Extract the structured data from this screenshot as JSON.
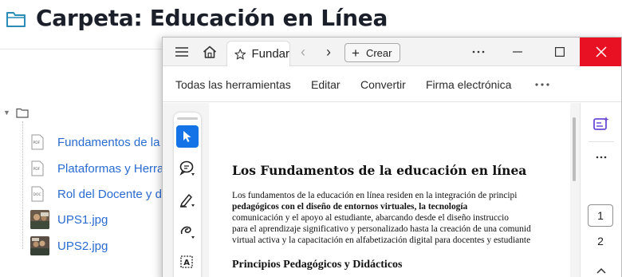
{
  "folder": {
    "title": "Carpeta: Educación en Línea",
    "files": [
      {
        "name": "Fundamentos de la",
        "type": "pdf"
      },
      {
        "name": "Plataformas y Herra",
        "type": "pdf"
      },
      {
        "name": "Rol del Docente y d",
        "type": "document"
      },
      {
        "name": "UPS1.jpg",
        "type": "image"
      },
      {
        "name": "UPS2.jpg",
        "type": "image"
      }
    ]
  },
  "viewer": {
    "tab_label": "Fundar",
    "crear_label": "Crear",
    "menu": {
      "all_tools": "Todas las herramientas",
      "edit": "Editar",
      "convert": "Convertir",
      "sign": "Firma electrónica"
    },
    "document": {
      "title": "Los Fundamentos de la educación en línea",
      "para_lines": [
        "Los fundamentos de la educación en línea residen en la integración de principi",
        "pedagógicos con el diseño de entornos virtuales, la tecnología",
        "comunicación y el apoyo al estudiante, abarcando desde el diseño instruccio",
        "para el aprendizaje significativo y personalizado hasta la creación de una comunid",
        "virtual activa y la capacitación en alfabetización digital para docentes y estudiante"
      ],
      "subheading": "Principios Pedagógicos y Didácticos"
    },
    "pagination": {
      "current": "1",
      "next": "2"
    }
  },
  "colors": {
    "accent": "#1473e6",
    "link": "#2a6bd0",
    "close_red": "#e81123",
    "ai_purple": "#6b4bd8"
  }
}
